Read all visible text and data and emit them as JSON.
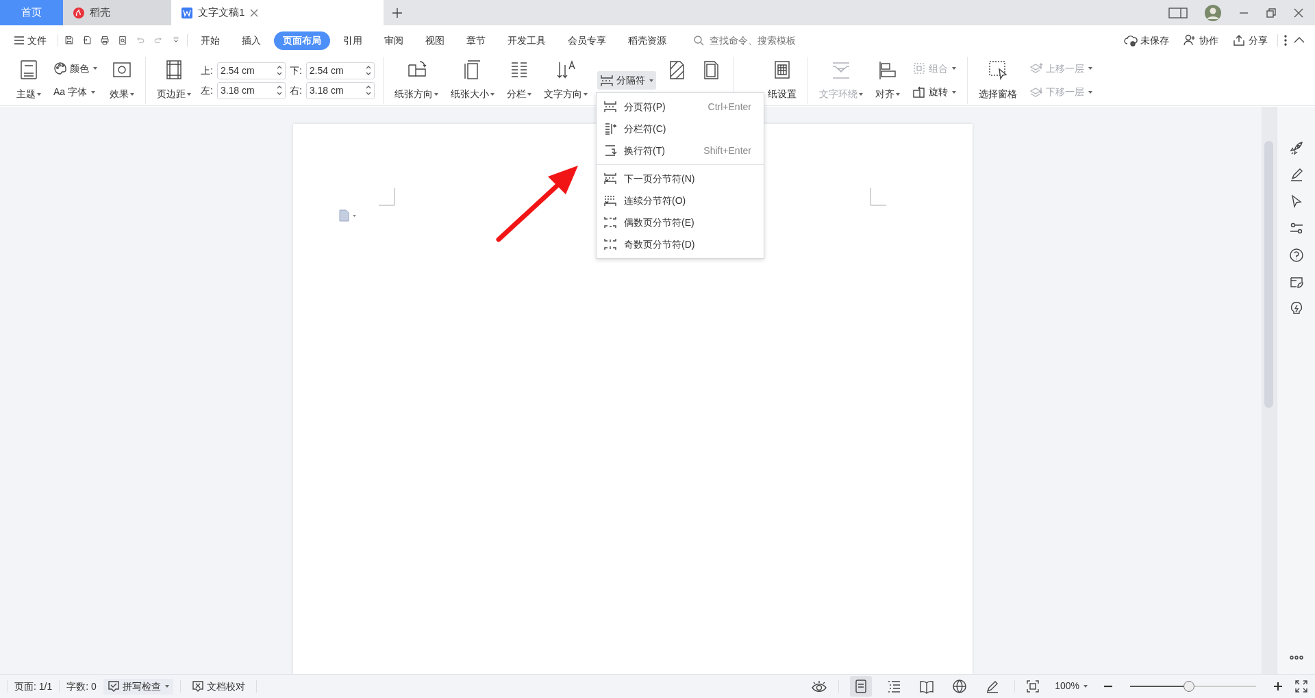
{
  "tabs": [
    {
      "label": "首页",
      "kind": "home",
      "selected": false
    },
    {
      "label": "稻壳",
      "kind": "docer",
      "selected": false
    },
    {
      "label": "文字文稿1",
      "kind": "doc",
      "selected": true
    }
  ],
  "menu": {
    "file": "文件",
    "items": [
      {
        "label": "开始",
        "selected": false
      },
      {
        "label": "插入",
        "selected": false
      },
      {
        "label": "页面布局",
        "selected": true
      },
      {
        "label": "引用",
        "selected": false
      },
      {
        "label": "审阅",
        "selected": false
      },
      {
        "label": "视图",
        "selected": false
      },
      {
        "label": "章节",
        "selected": false
      },
      {
        "label": "开发工具",
        "selected": false
      },
      {
        "label": "会员专享",
        "selected": false
      },
      {
        "label": "稻壳资源",
        "selected": false
      }
    ],
    "search": {
      "placeholder": "查找命令、搜索模板"
    },
    "actions": [
      "未保存",
      "协作",
      "分享"
    ]
  },
  "ribbon": [
    [
      {
        "kind": "big",
        "label": "主题",
        "caret": true,
        "disabled": false
      },
      {
        "kind": "stack",
        "rows": [
          {
            "label": "颜色",
            "caret": true,
            "disabled": false,
            "active": false
          },
          {
            "glyph": "Aa",
            "label": "字体",
            "caret": true,
            "disabled": false,
            "active": false
          }
        ]
      },
      {
        "kind": "big",
        "label": "效果",
        "caret": true,
        "disabled": false
      }
    ],
    [
      {
        "kind": "big",
        "label": "页边距",
        "caret": true,
        "disabled": false
      },
      {
        "kind": "margins",
        "fields": [
          {
            "label": "上:",
            "value": "2.54 cm"
          },
          {
            "label": "下:",
            "value": "2.54 cm"
          },
          {
            "label": "左:",
            "value": "3.18 cm"
          },
          {
            "label": "右:",
            "value": "3.18 cm"
          }
        ]
      }
    ],
    [
      {
        "kind": "big",
        "label": "纸张方向",
        "caret": true,
        "disabled": false
      },
      {
        "kind": "big",
        "label": "纸张大小",
        "caret": true,
        "disabled": false
      },
      {
        "kind": "big",
        "label": "分栏",
        "caret": true,
        "disabled": false
      },
      {
        "kind": "big",
        "label": "文字方向",
        "caret": true,
        "disabled": false
      },
      {
        "kind": "stack",
        "rows": [
          {
            "label": "分隔符",
            "caret": true,
            "disabled": false,
            "active": true
          }
        ]
      },
      {
        "kind": "big",
        "caret": false,
        "disabled": false
      },
      {
        "kind": "big",
        "caret": false,
        "disabled": false
      }
    ],
    [
      {
        "kind": "big",
        "label": "纸设置",
        "caret": false,
        "disabled": false
      }
    ],
    [
      {
        "kind": "big",
        "label": "文字环绕",
        "caret": true,
        "disabled": true
      },
      {
        "kind": "big",
        "label": "对齐",
        "caret": true,
        "disabled": false
      },
      {
        "kind": "stack",
        "rows": [
          {
            "label": "组合",
            "caret": true,
            "disabled": true,
            "active": false
          },
          {
            "label": "旋转",
            "caret": true,
            "disabled": false,
            "active": false
          }
        ]
      }
    ],
    [
      {
        "kind": "big",
        "label": "选择窗格",
        "caret": false,
        "disabled": false
      },
      {
        "kind": "stack",
        "rows": [
          {
            "label": "上移一层",
            "caret": true,
            "disabled": true,
            "active": false
          },
          {
            "label": "下移一层",
            "caret": true,
            "disabled": true,
            "active": false
          }
        ]
      }
    ]
  ],
  "break_menu": {
    "sections": [
      [
        {
          "label": "分页符(P)",
          "shortcut": "Ctrl+Enter"
        },
        {
          "label": "分栏符(C)"
        },
        {
          "label": "换行符(T)",
          "shortcut": "Shift+Enter"
        }
      ],
      [
        {
          "label": "下一页分节符(N)"
        },
        {
          "label": "连续分节符(O)"
        },
        {
          "label": "偶数页分节符(E)"
        },
        {
          "label": "奇数页分节符(D)"
        }
      ]
    ]
  },
  "status_bar": {
    "page": "页面: 1/1",
    "words": "字数: 0",
    "spell": "拼写检查",
    "proof": "文档校对",
    "views": [
      {
        "selected": true
      },
      {
        "selected": false
      },
      {
        "selected": false
      },
      {
        "selected": false
      },
      {
        "selected": false
      }
    ],
    "zoom": "100%",
    "zoom_level": {
      "level": 0.47
    }
  }
}
